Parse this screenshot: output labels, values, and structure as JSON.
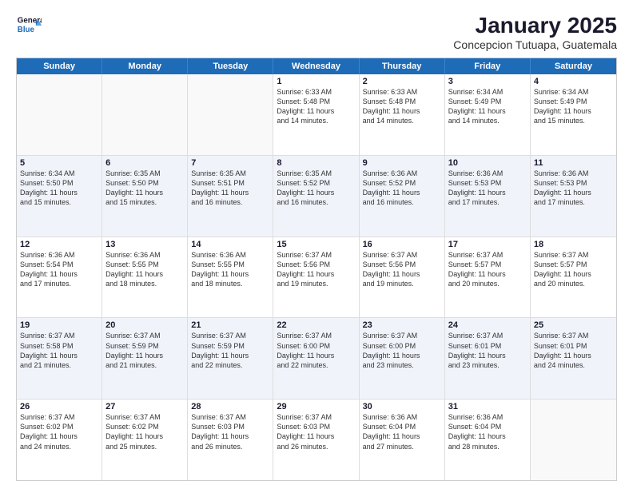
{
  "logo": {
    "general": "General",
    "blue": "Blue"
  },
  "header": {
    "title": "January 2025",
    "location": "Concepcion Tutuapa, Guatemala"
  },
  "days": [
    "Sunday",
    "Monday",
    "Tuesday",
    "Wednesday",
    "Thursday",
    "Friday",
    "Saturday"
  ],
  "weeks": [
    [
      {
        "day": "",
        "text": ""
      },
      {
        "day": "",
        "text": ""
      },
      {
        "day": "",
        "text": ""
      },
      {
        "day": "1",
        "text": "Sunrise: 6:33 AM\nSunset: 5:48 PM\nDaylight: 11 hours\nand 14 minutes."
      },
      {
        "day": "2",
        "text": "Sunrise: 6:33 AM\nSunset: 5:48 PM\nDaylight: 11 hours\nand 14 minutes."
      },
      {
        "day": "3",
        "text": "Sunrise: 6:34 AM\nSunset: 5:49 PM\nDaylight: 11 hours\nand 14 minutes."
      },
      {
        "day": "4",
        "text": "Sunrise: 6:34 AM\nSunset: 5:49 PM\nDaylight: 11 hours\nand 15 minutes."
      }
    ],
    [
      {
        "day": "5",
        "text": "Sunrise: 6:34 AM\nSunset: 5:50 PM\nDaylight: 11 hours\nand 15 minutes."
      },
      {
        "day": "6",
        "text": "Sunrise: 6:35 AM\nSunset: 5:50 PM\nDaylight: 11 hours\nand 15 minutes."
      },
      {
        "day": "7",
        "text": "Sunrise: 6:35 AM\nSunset: 5:51 PM\nDaylight: 11 hours\nand 16 minutes."
      },
      {
        "day": "8",
        "text": "Sunrise: 6:35 AM\nSunset: 5:52 PM\nDaylight: 11 hours\nand 16 minutes."
      },
      {
        "day": "9",
        "text": "Sunrise: 6:36 AM\nSunset: 5:52 PM\nDaylight: 11 hours\nand 16 minutes."
      },
      {
        "day": "10",
        "text": "Sunrise: 6:36 AM\nSunset: 5:53 PM\nDaylight: 11 hours\nand 17 minutes."
      },
      {
        "day": "11",
        "text": "Sunrise: 6:36 AM\nSunset: 5:53 PM\nDaylight: 11 hours\nand 17 minutes."
      }
    ],
    [
      {
        "day": "12",
        "text": "Sunrise: 6:36 AM\nSunset: 5:54 PM\nDaylight: 11 hours\nand 17 minutes."
      },
      {
        "day": "13",
        "text": "Sunrise: 6:36 AM\nSunset: 5:55 PM\nDaylight: 11 hours\nand 18 minutes."
      },
      {
        "day": "14",
        "text": "Sunrise: 6:36 AM\nSunset: 5:55 PM\nDaylight: 11 hours\nand 18 minutes."
      },
      {
        "day": "15",
        "text": "Sunrise: 6:37 AM\nSunset: 5:56 PM\nDaylight: 11 hours\nand 19 minutes."
      },
      {
        "day": "16",
        "text": "Sunrise: 6:37 AM\nSunset: 5:56 PM\nDaylight: 11 hours\nand 19 minutes."
      },
      {
        "day": "17",
        "text": "Sunrise: 6:37 AM\nSunset: 5:57 PM\nDaylight: 11 hours\nand 20 minutes."
      },
      {
        "day": "18",
        "text": "Sunrise: 6:37 AM\nSunset: 5:57 PM\nDaylight: 11 hours\nand 20 minutes."
      }
    ],
    [
      {
        "day": "19",
        "text": "Sunrise: 6:37 AM\nSunset: 5:58 PM\nDaylight: 11 hours\nand 21 minutes."
      },
      {
        "day": "20",
        "text": "Sunrise: 6:37 AM\nSunset: 5:59 PM\nDaylight: 11 hours\nand 21 minutes."
      },
      {
        "day": "21",
        "text": "Sunrise: 6:37 AM\nSunset: 5:59 PM\nDaylight: 11 hours\nand 22 minutes."
      },
      {
        "day": "22",
        "text": "Sunrise: 6:37 AM\nSunset: 6:00 PM\nDaylight: 11 hours\nand 22 minutes."
      },
      {
        "day": "23",
        "text": "Sunrise: 6:37 AM\nSunset: 6:00 PM\nDaylight: 11 hours\nand 23 minutes."
      },
      {
        "day": "24",
        "text": "Sunrise: 6:37 AM\nSunset: 6:01 PM\nDaylight: 11 hours\nand 23 minutes."
      },
      {
        "day": "25",
        "text": "Sunrise: 6:37 AM\nSunset: 6:01 PM\nDaylight: 11 hours\nand 24 minutes."
      }
    ],
    [
      {
        "day": "26",
        "text": "Sunrise: 6:37 AM\nSunset: 6:02 PM\nDaylight: 11 hours\nand 24 minutes."
      },
      {
        "day": "27",
        "text": "Sunrise: 6:37 AM\nSunset: 6:02 PM\nDaylight: 11 hours\nand 25 minutes."
      },
      {
        "day": "28",
        "text": "Sunrise: 6:37 AM\nSunset: 6:03 PM\nDaylight: 11 hours\nand 26 minutes."
      },
      {
        "day": "29",
        "text": "Sunrise: 6:37 AM\nSunset: 6:03 PM\nDaylight: 11 hours\nand 26 minutes."
      },
      {
        "day": "30",
        "text": "Sunrise: 6:36 AM\nSunset: 6:04 PM\nDaylight: 11 hours\nand 27 minutes."
      },
      {
        "day": "31",
        "text": "Sunrise: 6:36 AM\nSunset: 6:04 PM\nDaylight: 11 hours\nand 28 minutes."
      },
      {
        "day": "",
        "text": ""
      }
    ]
  ]
}
